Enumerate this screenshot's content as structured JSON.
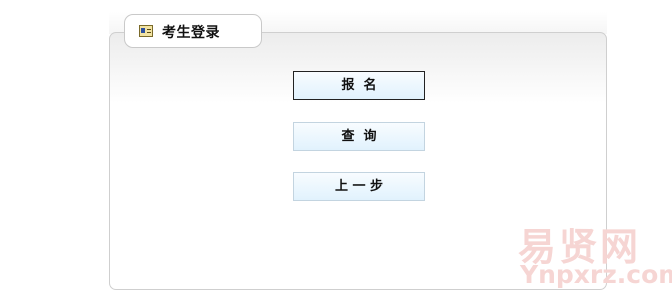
{
  "login_panel": {
    "title": "考生登录",
    "icon": "id-card-icon"
  },
  "buttons": {
    "register": "报  名",
    "query": "查  询",
    "back": "上 一 步"
  },
  "watermark": {
    "chinese": "易贤网",
    "latin": "Ynpxrz.com"
  }
}
